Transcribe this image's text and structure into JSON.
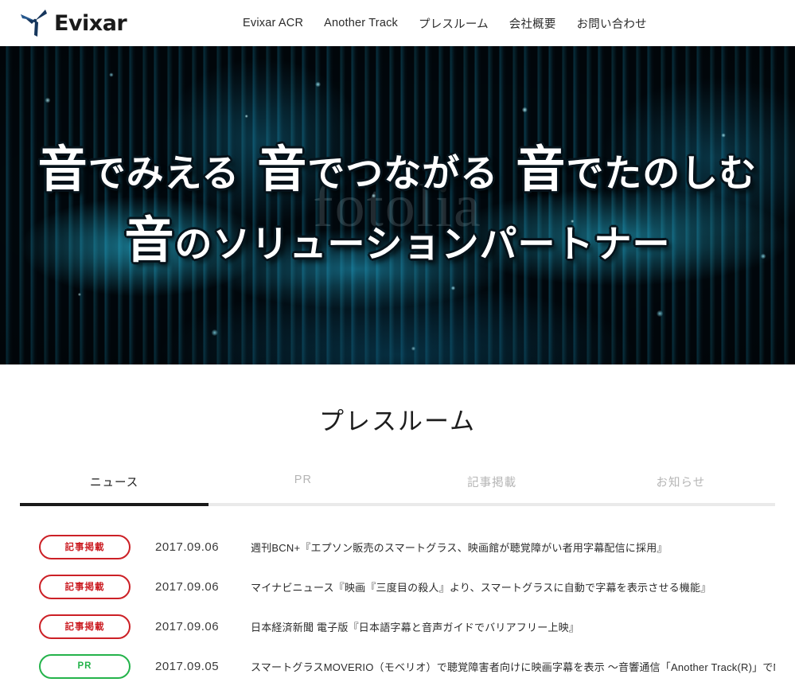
{
  "header": {
    "logo_text": "Evixar",
    "logo_icon": "evixar-propeller-logo",
    "nav": [
      {
        "label": "Evixar ACR"
      },
      {
        "label": "Another Track"
      },
      {
        "label": "プレスルーム"
      },
      {
        "label": "会社概要"
      },
      {
        "label": "お問い合わせ"
      }
    ]
  },
  "hero": {
    "watermark": "fotolia",
    "line1_a": "音",
    "line1_b": "でみえる",
    "line1_c": "音",
    "line1_d": "でつながる",
    "line1_e": "音",
    "line1_f": "でたのしむ",
    "line2_a": "音",
    "line2_b": "のソリューションパートナー"
  },
  "press": {
    "title": "プレスルーム",
    "tabs": [
      {
        "label": "ニュース",
        "active": true
      },
      {
        "label": "PR",
        "active": false
      },
      {
        "label": "記事掲載",
        "active": false
      },
      {
        "label": "お知らせ",
        "active": false
      }
    ],
    "rows": [
      {
        "badge": "記事掲載",
        "badge_color": "#cc2026",
        "date": "2017.09.06",
        "title": "週刊BCN+『エプソン販売のスマートグラス、映画館が聴覚障がい者用字幕配信に採用』"
      },
      {
        "badge": "記事掲載",
        "badge_color": "#cc2026",
        "date": "2017.09.06",
        "title": "マイナビニュース『映画『三度目の殺人』より、スマートグラスに自動で字幕を表示させる機能』"
      },
      {
        "badge": "記事掲載",
        "badge_color": "#cc2026",
        "date": "2017.09.06",
        "title": "日本経済新聞 電子版『日本語字幕と音声ガイドでバリアフリー上映』"
      },
      {
        "badge": "PR",
        "badge_color": "#24b34b",
        "date": "2017.09.05",
        "title": "スマートグラスMOVERIO（モベリオ）で聴覚障害者向けに映画字幕を表示 ～音響通信「Another Track(R)」でMOVERIO（モ"
      }
    ]
  },
  "colors": {
    "accent_red": "#cc2026",
    "accent_green": "#24b34b",
    "tab_active": "#1a1a1a",
    "tab_track": "#eaeaea"
  }
}
